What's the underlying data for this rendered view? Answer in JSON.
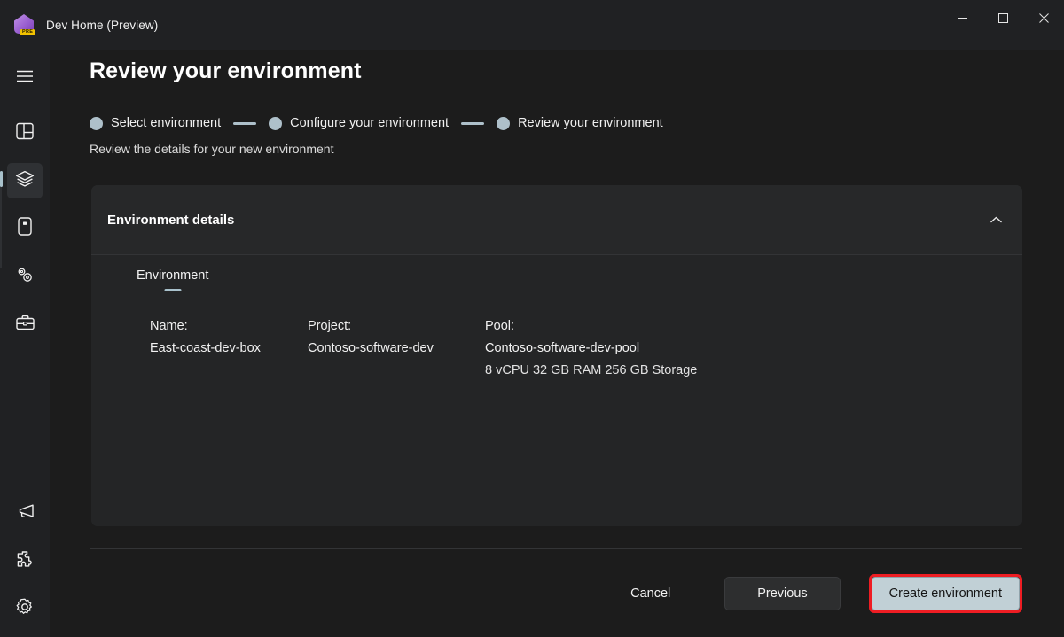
{
  "window": {
    "title": "Dev Home (Preview)",
    "app_icon": "dev-home-icon",
    "icon_badge": "PRE",
    "controls": {
      "minimize": "minimize-icon",
      "maximize": "maximize-icon",
      "close": "close-icon"
    }
  },
  "sidebar": {
    "menu_icon": "hamburger-menu-icon",
    "top_items": [
      {
        "icon": "dashboard-icon",
        "name": "sidebar-item-dashboard",
        "selected": false
      },
      {
        "icon": "layers-icon",
        "name": "sidebar-item-environments",
        "selected": true
      },
      {
        "icon": "machine-icon",
        "name": "sidebar-item-machine-configuration",
        "selected": false
      },
      {
        "icon": "extensions-gears-icon",
        "name": "sidebar-item-extensions",
        "selected": false
      },
      {
        "icon": "briefcase-icon",
        "name": "sidebar-item-utilities",
        "selected": false
      }
    ],
    "bottom_items": [
      {
        "icon": "megaphone-icon",
        "name": "sidebar-item-feedback"
      },
      {
        "icon": "puzzle-piece-icon",
        "name": "sidebar-item-extensions-library"
      },
      {
        "icon": "gear-icon",
        "name": "sidebar-item-settings"
      }
    ]
  },
  "page": {
    "title": "Review your environment",
    "subtitle": "Review the details for your new environment"
  },
  "stepper": {
    "steps": [
      {
        "label": "Select environment"
      },
      {
        "label": "Configure your environment"
      },
      {
        "label": "Review your environment"
      }
    ]
  },
  "card": {
    "header": "Environment details",
    "collapse_icon": "chevron-up-icon",
    "tabs": [
      {
        "label": "Environment",
        "active": true
      }
    ],
    "fields": [
      {
        "label": "Name:",
        "value": "East-coast-dev-box",
        "sub": ""
      },
      {
        "label": "Project:",
        "value": "Contoso-software-dev",
        "sub": ""
      },
      {
        "label": "Pool:",
        "value": "Contoso-software-dev-pool",
        "sub": "8 vCPU 32 GB RAM 256 GB Storage"
      }
    ]
  },
  "footer": {
    "cancel_label": "Cancel",
    "previous_label": "Previous",
    "create_label": "Create environment"
  },
  "colors": {
    "accent": "#a9c2cc",
    "primary_button_bg": "#c1d0d6",
    "highlight_border": "#ee1d23",
    "window_chrome": "#202123",
    "page_bg": "#1c1c1c",
    "card_bg": "#272829",
    "card_body_bg": "#242526"
  }
}
